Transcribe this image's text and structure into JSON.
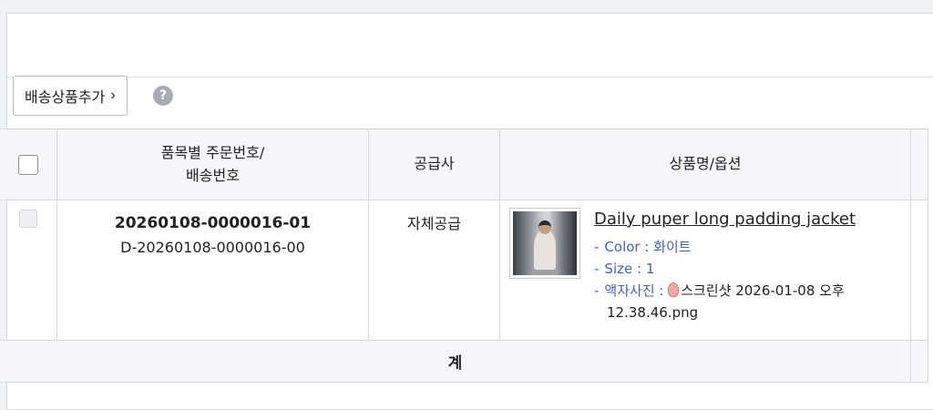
{
  "toolbar": {
    "add_shipping_product_label": "배송상품추가",
    "chevron": "›",
    "help_symbol": "?"
  },
  "table": {
    "headers": {
      "order_line1": "품목별 주문번호/",
      "order_line2": "배송번호",
      "supplier": "공급사",
      "product": "상품명/옵션"
    },
    "row": {
      "order_no": "20260108-0000016-01",
      "shipping_no": "D-20260108-0000016-00",
      "supplier": "자체공급",
      "product_name": "Daily puper long padding jacket",
      "options": {
        "color_key": "Color :",
        "color_value": "화이트",
        "size_key": "Size :",
        "size_value": "1",
        "photo_key": "액자사진 :",
        "photo_file_line1": "스크린샷 2026-01-08 오후",
        "photo_file_line2": "12.38.46.png"
      }
    },
    "footer_total": "계"
  },
  "icons": {
    "help": "help-circle-icon",
    "checkbox": "checkbox-icon",
    "ear": "ear-emoji-icon"
  },
  "colors": {
    "option_blue": "#3a63d2",
    "header_bg": "#f6f6f8"
  }
}
